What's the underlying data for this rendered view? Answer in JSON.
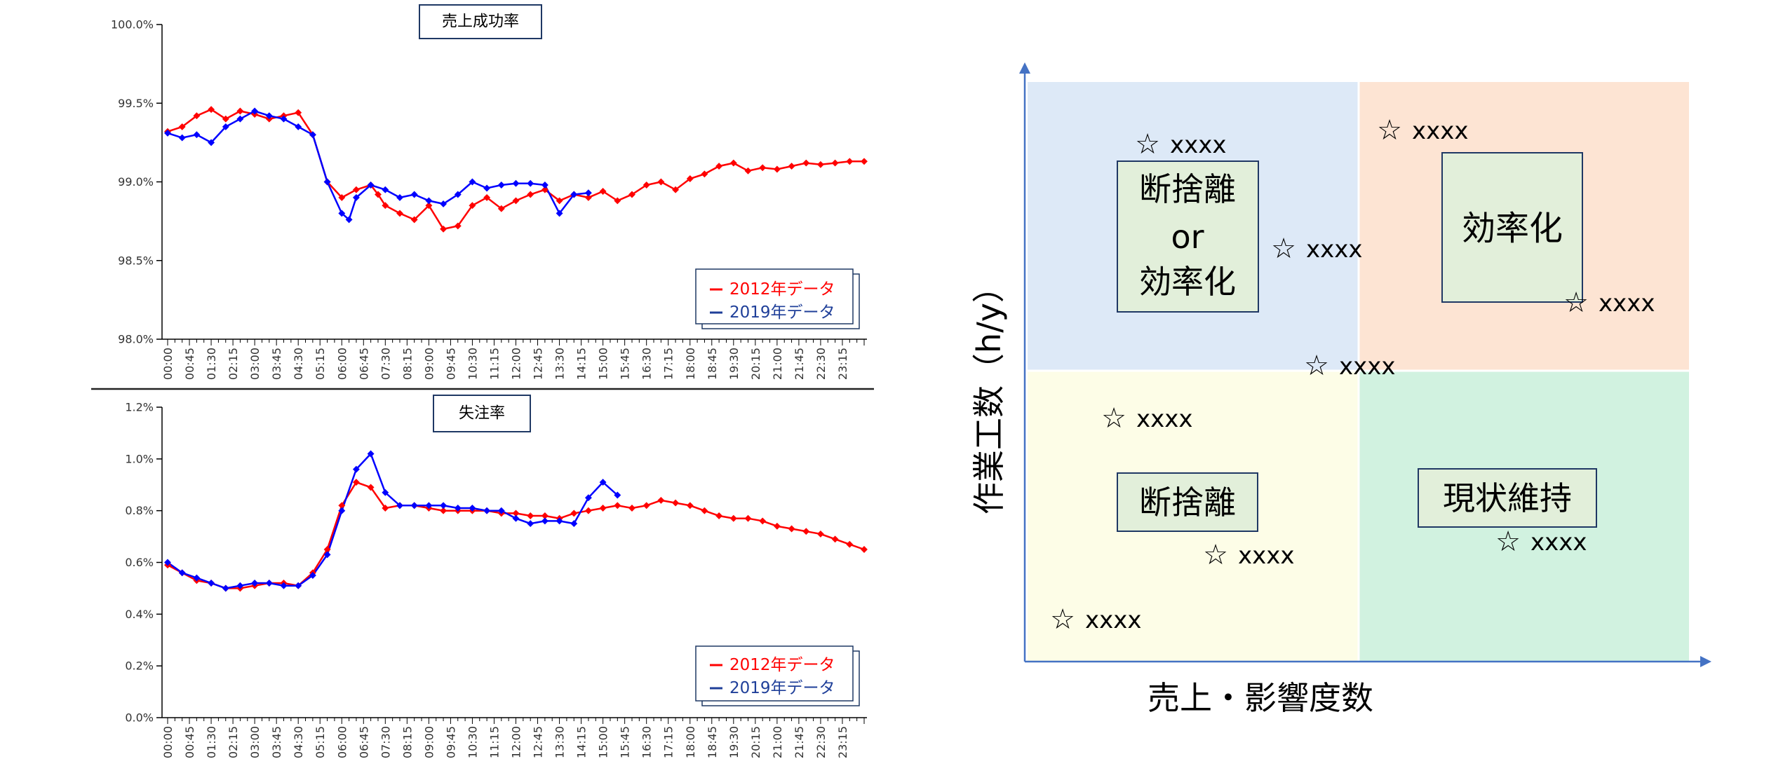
{
  "chart_data": [
    {
      "type": "line",
      "title": "売上成功率",
      "y_ticks": [
        "100.0%",
        "99.5%",
        "99.0%",
        "98.5%",
        "98.0%"
      ],
      "ylim": [
        98.0,
        100.0
      ],
      "x_ticks": [
        "00:00",
        "00:45",
        "01:30",
        "02:15",
        "03:00",
        "03:45",
        "04:30",
        "05:15",
        "06:00",
        "06:45",
        "07:30",
        "08:15",
        "09:00",
        "09:45",
        "10:30",
        "11:15",
        "12:00",
        "12:45",
        "13:30",
        "14:15",
        "15:00",
        "15:45",
        "16:30",
        "17:15",
        "18:00",
        "18:45",
        "19:30",
        "20:15",
        "21:00",
        "21:45",
        "22:30",
        "23:15"
      ],
      "x_range_minutes": [
        0,
        1440
      ],
      "legend_position": "bottom-right",
      "series": [
        {
          "name": "2012年データ",
          "color": "#ff0000",
          "x": [
            0,
            30,
            60,
            90,
            120,
            150,
            180,
            210,
            240,
            270,
            300,
            330,
            360,
            390,
            420,
            435,
            450,
            480,
            510,
            540,
            570,
            600,
            630,
            660,
            690,
            720,
            750,
            780,
            810,
            840,
            870,
            900,
            930,
            960,
            990,
            1020,
            1050,
            1080,
            1110,
            1140,
            1170,
            1200,
            1230,
            1260,
            1290,
            1320,
            1350,
            1380,
            1410,
            1440
          ],
          "values": [
            99.32,
            99.35,
            99.42,
            99.46,
            99.4,
            99.45,
            99.43,
            99.4,
            99.42,
            99.44,
            99.3,
            99.0,
            98.9,
            98.95,
            98.98,
            98.92,
            98.85,
            98.8,
            98.76,
            98.85,
            98.7,
            98.72,
            98.85,
            98.9,
            98.83,
            98.88,
            98.92,
            98.95,
            98.88,
            98.92,
            98.9,
            98.94,
            98.88,
            98.92,
            98.98,
            99.0,
            98.95,
            99.02,
            99.05,
            99.1,
            99.12,
            99.07,
            99.09,
            99.08,
            99.1,
            99.12,
            99.11,
            99.12,
            99.13,
            99.13
          ]
        },
        {
          "name": "2019年データ",
          "color": "#0000ff",
          "x": [
            0,
            30,
            60,
            90,
            120,
            150,
            180,
            210,
            240,
            270,
            300,
            330,
            360,
            375,
            390,
            420,
            450,
            480,
            510,
            540,
            570,
            600,
            630,
            660,
            690,
            720,
            750,
            780,
            810,
            840,
            870
          ],
          "values": [
            99.31,
            99.28,
            99.3,
            99.25,
            99.35,
            99.4,
            99.45,
            99.42,
            99.4,
            99.35,
            99.3,
            99.0,
            98.8,
            98.76,
            98.9,
            98.98,
            98.95,
            98.9,
            98.92,
            98.88,
            98.86,
            98.92,
            99.0,
            98.96,
            98.98,
            98.99,
            98.99,
            98.98,
            98.8,
            98.92,
            98.93
          ]
        }
      ]
    },
    {
      "type": "line",
      "title": "失注率",
      "y_ticks": [
        "1.2%",
        "1.0%",
        "0.8%",
        "0.6%",
        "0.4%",
        "0.2%",
        "0.0%"
      ],
      "ylim": [
        0.0,
        1.2
      ],
      "x_ticks": [
        "00:00",
        "00:45",
        "01:30",
        "02:15",
        "03:00",
        "03:45",
        "04:30",
        "05:15",
        "06:00",
        "06:45",
        "07:30",
        "08:15",
        "09:00",
        "09:45",
        "10:30",
        "11:15",
        "12:00",
        "12:45",
        "13:30",
        "14:15",
        "15:00",
        "15:45",
        "16:30",
        "17:15",
        "18:00",
        "18:45",
        "19:30",
        "20:15",
        "21:00",
        "21:45",
        "22:30",
        "23:15"
      ],
      "x_range_minutes": [
        0,
        1440
      ],
      "legend_position": "bottom-right",
      "series": [
        {
          "name": "2012年データ",
          "color": "#ff0000",
          "x": [
            0,
            30,
            60,
            90,
            120,
            150,
            180,
            210,
            240,
            270,
            300,
            330,
            360,
            390,
            420,
            450,
            480,
            510,
            540,
            570,
            600,
            630,
            660,
            690,
            720,
            750,
            780,
            810,
            840,
            870,
            900,
            930,
            960,
            990,
            1020,
            1050,
            1080,
            1110,
            1140,
            1170,
            1200,
            1230,
            1260,
            1290,
            1320,
            1350,
            1380,
            1410,
            1440
          ],
          "values": [
            0.59,
            0.56,
            0.53,
            0.52,
            0.5,
            0.5,
            0.51,
            0.52,
            0.52,
            0.51,
            0.56,
            0.65,
            0.82,
            0.91,
            0.89,
            0.81,
            0.82,
            0.82,
            0.81,
            0.8,
            0.8,
            0.8,
            0.8,
            0.79,
            0.79,
            0.78,
            0.78,
            0.77,
            0.79,
            0.8,
            0.81,
            0.82,
            0.81,
            0.82,
            0.84,
            0.83,
            0.82,
            0.8,
            0.78,
            0.77,
            0.77,
            0.76,
            0.74,
            0.73,
            0.72,
            0.71,
            0.69,
            0.67,
            0.65
          ]
        },
        {
          "name": "2019年データ",
          "color": "#0000ff",
          "x": [
            0,
            30,
            60,
            90,
            120,
            150,
            180,
            210,
            240,
            270,
            300,
            330,
            360,
            390,
            420,
            450,
            480,
            510,
            540,
            570,
            600,
            630,
            660,
            690,
            720,
            750,
            780,
            810,
            840,
            870,
            900,
            930
          ],
          "values": [
            0.6,
            0.56,
            0.54,
            0.52,
            0.5,
            0.51,
            0.52,
            0.52,
            0.51,
            0.51,
            0.55,
            0.63,
            0.8,
            0.96,
            1.02,
            0.87,
            0.82,
            0.82,
            0.82,
            0.82,
            0.81,
            0.81,
            0.8,
            0.8,
            0.77,
            0.75,
            0.76,
            0.76,
            0.75,
            0.85,
            0.91,
            0.86
          ]
        }
      ]
    }
  ],
  "matrix": {
    "x_axis_label": "売上・影響度数",
    "y_axis_label": "作業工数（h/y）",
    "quadrant_colors": {
      "top_left": "#dde9f7",
      "top_right": "#fde4d3",
      "bottom_left": "#fdfde7",
      "bottom_right": "#d1f2e0"
    },
    "box_fill": "#e2efda",
    "box_border": "#1f3864",
    "axis_color": "#4472c4",
    "boxes": {
      "top_left_line1": "断捨離",
      "top_left_line2": "or",
      "top_left_line3": "効率化",
      "top_right": "効率化",
      "bottom_left": "断捨離",
      "bottom_right": "現状維持"
    },
    "items": [
      {
        "label": "xxxx",
        "quadrant": "top-left"
      },
      {
        "label": "xxxx",
        "quadrant": "top-left"
      },
      {
        "label": "xxxx",
        "quadrant": "top-right"
      },
      {
        "label": "xxxx",
        "quadrant": "top-right"
      },
      {
        "label": "xxxx",
        "quadrant": "center"
      },
      {
        "label": "xxxx",
        "quadrant": "bottom-left"
      },
      {
        "label": "xxxx",
        "quadrant": "bottom-left"
      },
      {
        "label": "xxxx",
        "quadrant": "bottom-left"
      },
      {
        "label": "xxxx",
        "quadrant": "bottom-right"
      }
    ]
  }
}
